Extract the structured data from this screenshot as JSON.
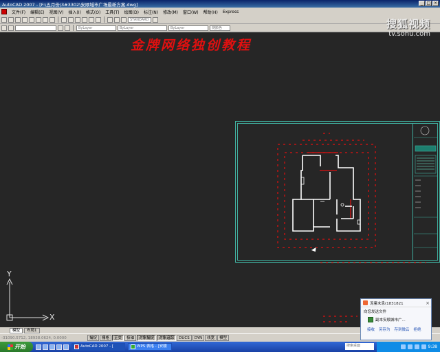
{
  "window": {
    "title": "AutoCAD 2007 - [F:\\五月份\\3#3302\\安顺城市广场最新方案.dwg]",
    "buttons": [
      "_",
      "□",
      "×"
    ]
  },
  "menu": [
    "文件(F)",
    "编辑(E)",
    "视图(V)",
    "插入(I)",
    "格式(O)",
    "工具(T)",
    "绘图(D)",
    "标注(N)",
    "修改(M)",
    "窗口(W)",
    "帮助(H)",
    "Express"
  ],
  "toolbar": {
    "style_dropdown": "STANDARD",
    "layer_dropdown": "ByLayer",
    "linetype_dropdown": "ByLayer",
    "lineweight_dropdown": "ByLayer",
    "color_dropdown": "随颜色"
  },
  "watermark": {
    "logo": "搜狐视频",
    "url": "tv.sohu.com"
  },
  "banner": "金牌网络独创教程",
  "ucs": {
    "x": "X",
    "y": "Y"
  },
  "layout_tabs": [
    "模型",
    "布局1"
  ],
  "status": {
    "coords": "-31090.5712, 18938.0624, 0.0000",
    "buttons": [
      "捕捉",
      "栅格",
      "正交",
      "极轴",
      "对象捕捉",
      "对象追踪",
      "DUCS",
      "DYN",
      "线宽",
      "模型"
    ]
  },
  "taskbar": {
    "start": "开始",
    "tasks": [
      "AutoCAD 2007 - [",
      "WPS 表格 - [安顺"
    ],
    "search_placeholder": "搜索桌面",
    "clock": "9:38"
  },
  "popup": {
    "sender": "泥鉴未息(1831821",
    "message": "向您发送文件",
    "filename": "副本安顺城市广...",
    "actions": [
      "接收",
      "另存为",
      "存到微云",
      "拒绝"
    ]
  },
  "colors": {
    "canvas": "#262626",
    "banner": "#e01010",
    "frame": "#40b0a0",
    "plan_lines": "#ffffff",
    "dimensions": "#e01010"
  }
}
